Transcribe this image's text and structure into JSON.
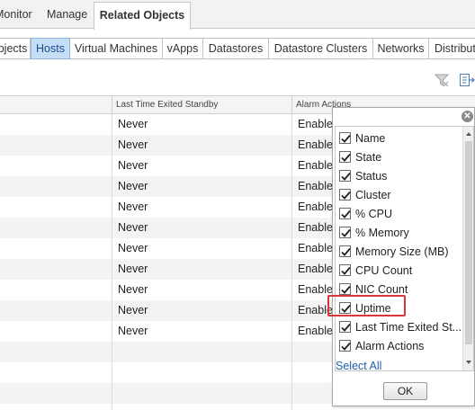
{
  "top_tabs": [
    {
      "label": "Monitor"
    },
    {
      "label": "Manage"
    },
    {
      "label": "Related Objects"
    }
  ],
  "sub_tabs": [
    {
      "label": "Objects"
    },
    {
      "label": "Hosts"
    },
    {
      "label": "Virtual Machines"
    },
    {
      "label": "vApps"
    },
    {
      "label": "Datastores"
    },
    {
      "label": "Datastore Clusters"
    },
    {
      "label": "Networks"
    },
    {
      "label": "Distributed"
    }
  ],
  "columns": {
    "last_time_exited_standby": "Last Time Exited Standby",
    "alarm_actions": "Alarm Actions"
  },
  "rows": [
    {
      "exited": "Never",
      "alarm": "Enabled"
    },
    {
      "exited": "Never",
      "alarm": "Enabled"
    },
    {
      "exited": "Never",
      "alarm": "Enabled"
    },
    {
      "exited": "Never",
      "alarm": "Enabled"
    },
    {
      "exited": "Never",
      "alarm": "Enabled"
    },
    {
      "exited": "Never",
      "alarm": "Enabled"
    },
    {
      "exited": "Never",
      "alarm": "Enabled"
    },
    {
      "exited": "Never",
      "alarm": "Enabled"
    },
    {
      "exited": "Never",
      "alarm": "Enabled"
    },
    {
      "exited": "Never",
      "alarm": "Enabled"
    },
    {
      "exited": "Never",
      "alarm": "Enabled"
    }
  ],
  "column_picker": {
    "options": [
      {
        "label": "Name",
        "checked": true
      },
      {
        "label": "State",
        "checked": true
      },
      {
        "label": "Status",
        "checked": true
      },
      {
        "label": "Cluster",
        "checked": true
      },
      {
        "label": "% CPU",
        "checked": true
      },
      {
        "label": "% Memory",
        "checked": true
      },
      {
        "label": "Memory Size (MB)",
        "checked": true
      },
      {
        "label": "CPU Count",
        "checked": true
      },
      {
        "label": "NIC Count",
        "checked": true
      },
      {
        "label": "Uptime",
        "checked": true
      },
      {
        "label": "Last Time Exited St...",
        "checked": true
      },
      {
        "label": "Alarm Actions",
        "checked": true
      }
    ],
    "select_all": "Select All",
    "ok": "OK",
    "highlighted_option": "Uptime"
  },
  "colors": {
    "active_subtab_bg": "#c5ddf5",
    "highlight_border": "#d9363e",
    "link": "#1f5fb0"
  },
  "icons": {
    "filter": "filter-clear-icon",
    "export": "export-icon",
    "close": "close-icon",
    "checkbox": "checkmark-icon"
  }
}
